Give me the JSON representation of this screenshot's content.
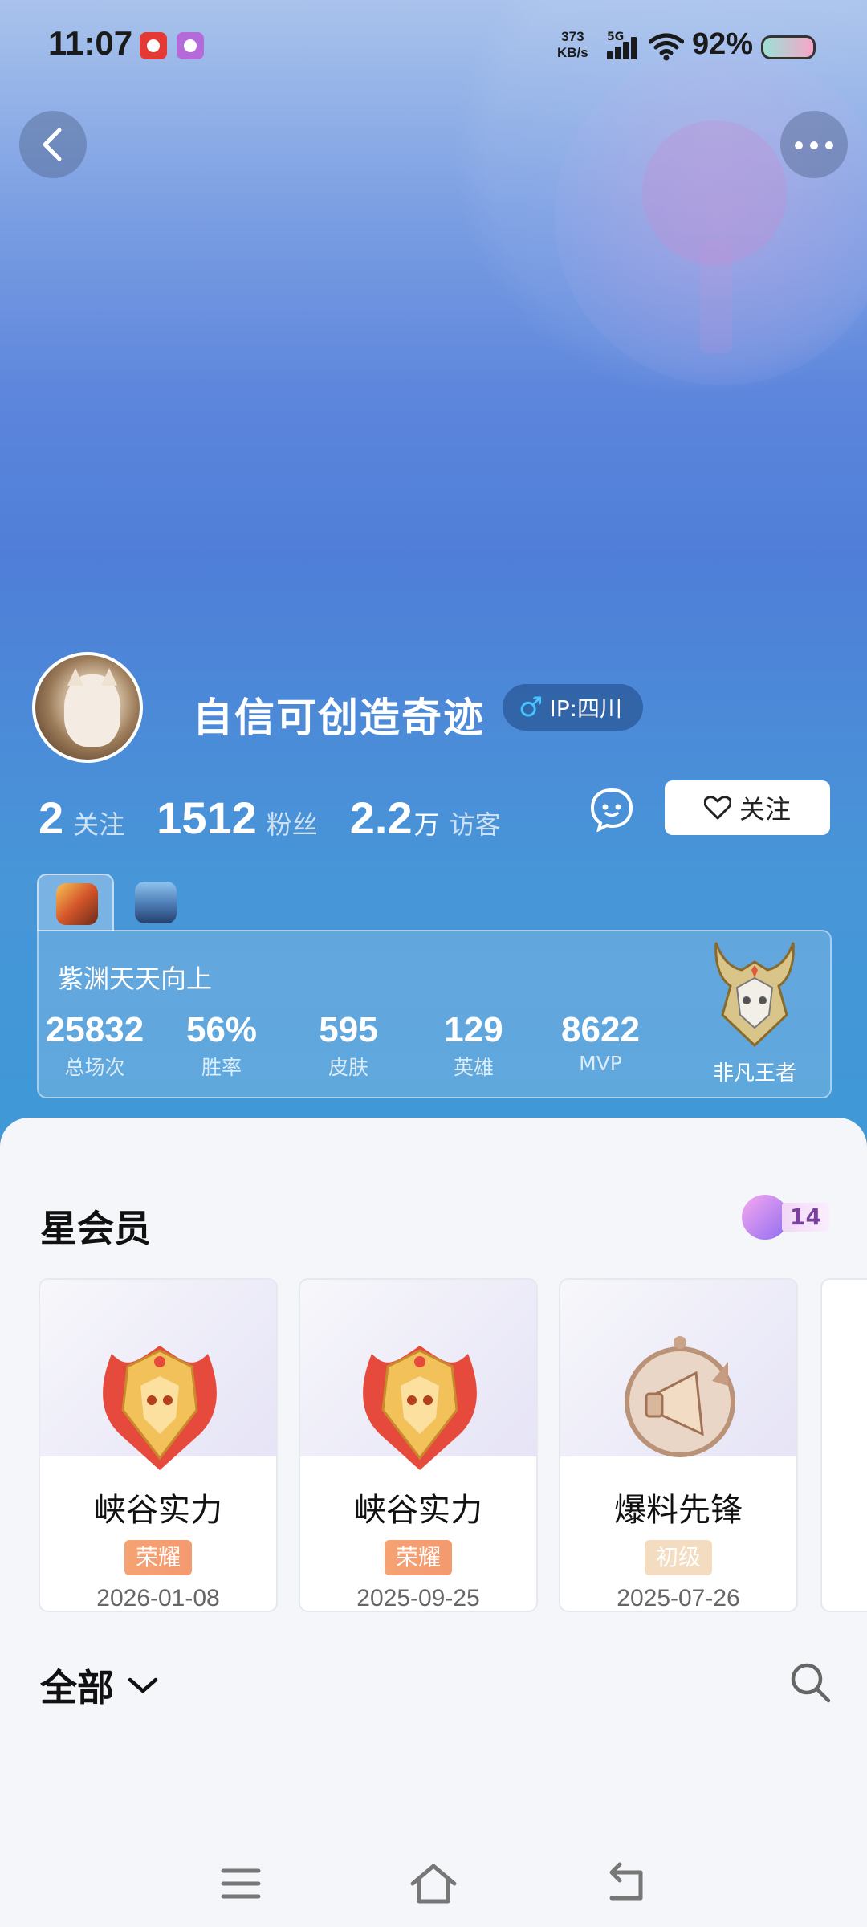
{
  "status_bar": {
    "time": "11:07",
    "net_speed_value": "373",
    "net_speed_unit": "KB/s",
    "network": "5G",
    "battery": "92%"
  },
  "profile": {
    "username": "自信可创造奇迹",
    "ip_label": "IP:四川",
    "gender_icon": "male-icon",
    "stats": {
      "following_num": "2",
      "following_label": "关注",
      "fans_num": "1512",
      "fans_label": "粉丝",
      "visitors_num": "2.2",
      "visitors_unit": "万",
      "visitors_label": "访客"
    },
    "follow_button": "关注"
  },
  "game_card": {
    "role_name": "紫渊天天向上",
    "stats": [
      {
        "value": "25832",
        "label": "总场次"
      },
      {
        "value": "56%",
        "label": "胜率"
      },
      {
        "value": "595",
        "label": "皮肤"
      },
      {
        "value": "129",
        "label": "英雄"
      },
      {
        "value": "8622",
        "label": "MVP"
      }
    ],
    "rank_name": "非凡王者"
  },
  "star_member": {
    "title": "星会员",
    "level": "14",
    "badges": [
      {
        "name": "峡谷实力",
        "tier": "荣耀",
        "date": "2026-01-08"
      },
      {
        "name": "峡谷实力",
        "tier": "荣耀",
        "date": "2025-09-25"
      },
      {
        "name": "爆料先锋",
        "tier": "初级",
        "date": "2025-07-26"
      }
    ]
  },
  "feed": {
    "filter_label": "全部"
  },
  "colors": {
    "hero_top": "#a9c3ec",
    "hero_bottom": "#3f98d6",
    "tier_glory": "#f39a6f",
    "tier_junior": "#f4dcc0"
  }
}
